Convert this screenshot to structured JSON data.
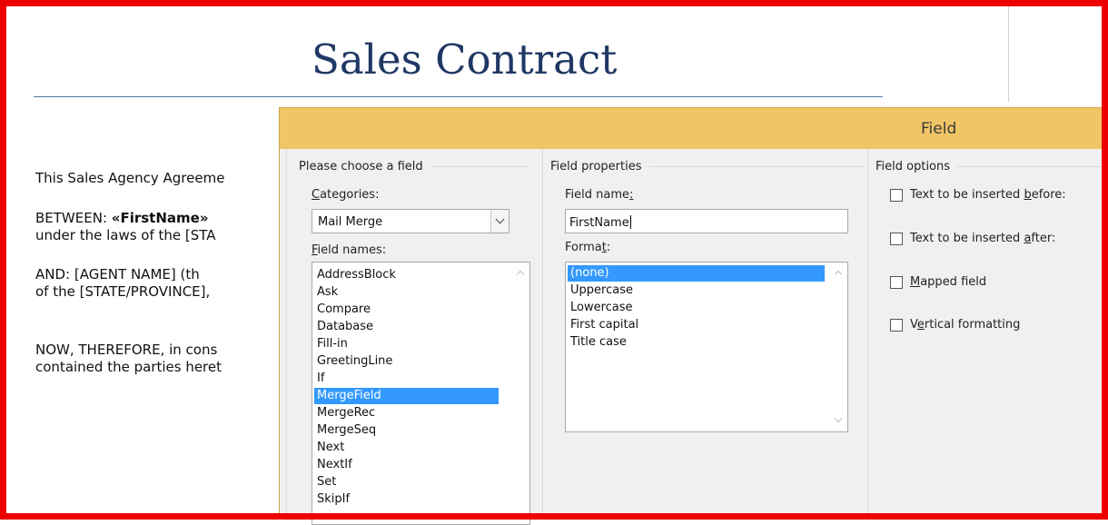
{
  "document": {
    "title": "Sales Contract",
    "line1": "This Sales Agency Agreeme",
    "line2_prefix": "BETWEEN: ",
    "line2_field": "«FirstName»",
    "line3": "under the laws of the [STA",
    "line4": "AND:    [AGENT NAME] (th",
    "line5": "of the [STATE/PROVINCE],",
    "line6": "NOW, THEREFORE, in cons",
    "line7": "contained the parties heret"
  },
  "dialog": {
    "title": "Field",
    "choose_group": "Please choose a field",
    "categories_label": "Categories:",
    "categories_value": "Mail Merge",
    "field_names_label": "Field names:",
    "field_names": [
      "AddressBlock",
      "Ask",
      "Compare",
      "Database",
      "Fill-in",
      "GreetingLine",
      "If",
      "MergeField",
      "MergeRec",
      "MergeSeq",
      "Next",
      "NextIf",
      "Set",
      "SkipIf"
    ],
    "field_names_selected": "MergeField",
    "properties_group": "Field properties",
    "field_name_label": "Field name:",
    "field_name_value": "FirstName",
    "format_label": "Format:",
    "formats": [
      "(none)",
      "Uppercase",
      "Lowercase",
      "First capital",
      "Title case"
    ],
    "format_selected": "(none)",
    "options_group": "Field options",
    "options": [
      {
        "label": "Text to be inserted before:",
        "checked": false
      },
      {
        "label": "Text to be inserted after:",
        "checked": false
      },
      {
        "label": "Mapped field",
        "checked": false
      },
      {
        "label": "Vertical formatting",
        "checked": false
      }
    ]
  }
}
